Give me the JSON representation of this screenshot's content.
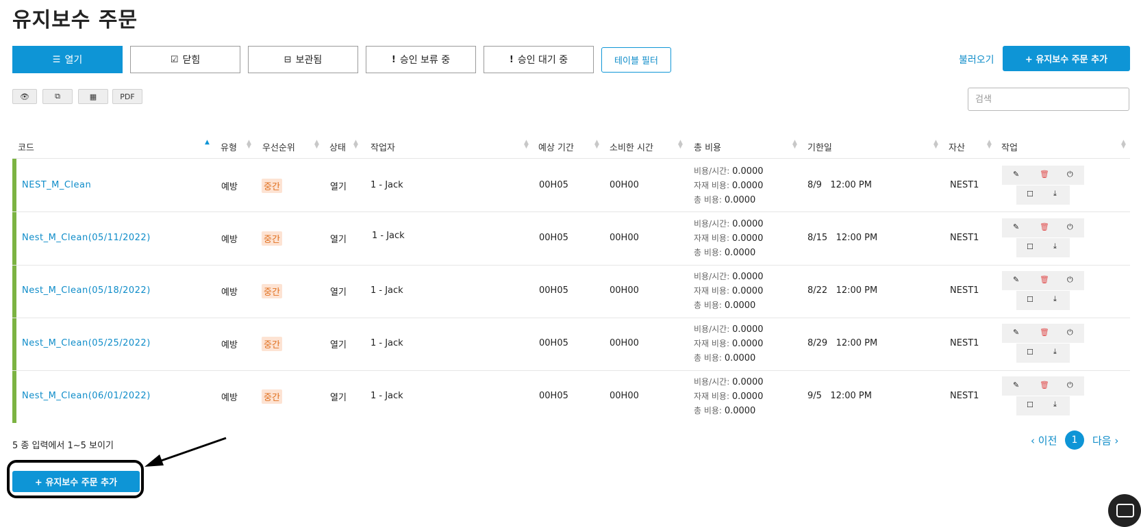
{
  "page": {
    "title": "유지보수 주문"
  },
  "tabs": [
    {
      "label": "열기",
      "icon": "list-icon",
      "active": true
    },
    {
      "label": "닫힘",
      "icon": "check-square-icon",
      "active": false
    },
    {
      "label": "보관됨",
      "icon": "inbox-icon",
      "active": false
    },
    {
      "label": "승인 보류 중",
      "icon": "exclamation-icon",
      "active": false
    },
    {
      "label": "승인 대기 중",
      "icon": "exclamation-icon",
      "active": false
    }
  ],
  "toolbar": {
    "table_filter": "테이블 필터",
    "load": "불러오기",
    "add_order": "+ 유지보수 주문 추가",
    "pdf": "PDF",
    "search_placeholder": "검색"
  },
  "columns": {
    "code": "코드",
    "type": "유형",
    "priority": "우선순위",
    "status": "상태",
    "worker": "작업자",
    "est_time": "예상 기간",
    "spent_time": "소비한 시간",
    "total_cost": "총 비용",
    "due": "기한일",
    "asset": "자산",
    "action": "작업"
  },
  "cost_labels": {
    "hourly": "비용/시간:",
    "material": "자재 비용:",
    "total": "총 비용:"
  },
  "rows": [
    {
      "code": "NEST_M_Clean",
      "type": "예방",
      "priority": "중간",
      "status": "열기",
      "worker": "1 - Jack",
      "est": "00H05",
      "spent": "00H00",
      "hourly": "0.0000",
      "material": "0.0000",
      "total": "0.0000",
      "due": "8/9   12:00 PM",
      "asset": "NEST1"
    },
    {
      "code": "Nest_M_Clean(05/11/2022)",
      "type": "예방",
      "priority": "중간",
      "status": "열기",
      "worker": "1 - Jack",
      "est": "00H05",
      "spent": "00H00",
      "hourly": "0.0000",
      "material": "0.0000",
      "total": "0.0000",
      "due": "8/15   12:00 PM",
      "asset": "NEST1"
    },
    {
      "code": "Nest_M_Clean(05/18/2022)",
      "type": "예방",
      "priority": "중간",
      "status": "열기",
      "worker": "1 - Jack",
      "est": "00H05",
      "spent": "00H00",
      "hourly": "0.0000",
      "material": "0.0000",
      "total": "0.0000",
      "due": "8/22   12:00 PM",
      "asset": "NEST1"
    },
    {
      "code": "Nest_M_Clean(05/25/2022)",
      "type": "예방",
      "priority": "중간",
      "status": "열기",
      "worker": "1 - Jack",
      "est": "00H05",
      "spent": "00H00",
      "hourly": "0.0000",
      "material": "0.0000",
      "total": "0.0000",
      "due": "8/29   12:00 PM",
      "asset": "NEST1"
    },
    {
      "code": "Nest_M_Clean(06/01/2022)",
      "type": "예방",
      "priority": "중간",
      "status": "열기",
      "worker": "1 - Jack",
      "est": "00H05",
      "spent": "00H00",
      "hourly": "0.0000",
      "material": "0.0000",
      "total": "0.0000",
      "due": "9/5   12:00 PM",
      "asset": "NEST1"
    }
  ],
  "footer": {
    "info": "5 종 입력에서 1~5 보이기",
    "prev": "‹ 이전",
    "page": "1",
    "next": "다음 ›",
    "add_order": "+ 유지보수 주문 추가"
  },
  "colors": {
    "accent": "#0e95d6",
    "row_bar": "#7cb342",
    "badge_bg": "#fde3d3",
    "badge_text": "#e0701f"
  }
}
